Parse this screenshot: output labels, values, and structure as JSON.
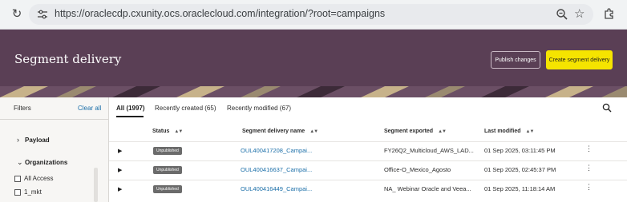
{
  "browser": {
    "url": "https://oraclecdp.cxunity.ocs.oraclecloud.com/integration/?root=campaigns"
  },
  "header": {
    "title": "Segment delivery",
    "publish_label": "Publish changes",
    "create_label": "Create segment delivery",
    "banner_color": "#5a3f55",
    "accent_color": "#f5e400"
  },
  "filters": {
    "title": "Filters",
    "clear_all": "Clear all",
    "groups": [
      {
        "label": "Payload",
        "expanded": false
      },
      {
        "label": "Organizations",
        "expanded": true
      }
    ],
    "organizations": [
      "All Access",
      "1_mkt"
    ]
  },
  "tabs": [
    {
      "label": "All (1997)",
      "active": true
    },
    {
      "label": "Recently created (65)",
      "active": false
    },
    {
      "label": "Recently modified (67)",
      "active": false
    }
  ],
  "table": {
    "columns": [
      "Status",
      "Segment delivery name",
      "Segment exported",
      "Last modified"
    ],
    "rows": [
      {
        "status": "Unpublished",
        "name": "OUL400417208_Campai...",
        "segment": "FY26Q2_Multicloud_AWS_LAD...",
        "modified": "01 Sep 2025, 03:11:45 PM"
      },
      {
        "status": "Unpublished",
        "name": "OUL400416637_Campai...",
        "segment": "Office-O_Mexico_Agosto",
        "modified": "01 Sep 2025, 02:45:37 PM"
      },
      {
        "status": "Unpublished",
        "name": "OUL400416449_Campai...",
        "segment": "NA_ Webinar Oracle and Veea...",
        "modified": "01 Sep 2025, 11:18:14 AM"
      }
    ]
  }
}
